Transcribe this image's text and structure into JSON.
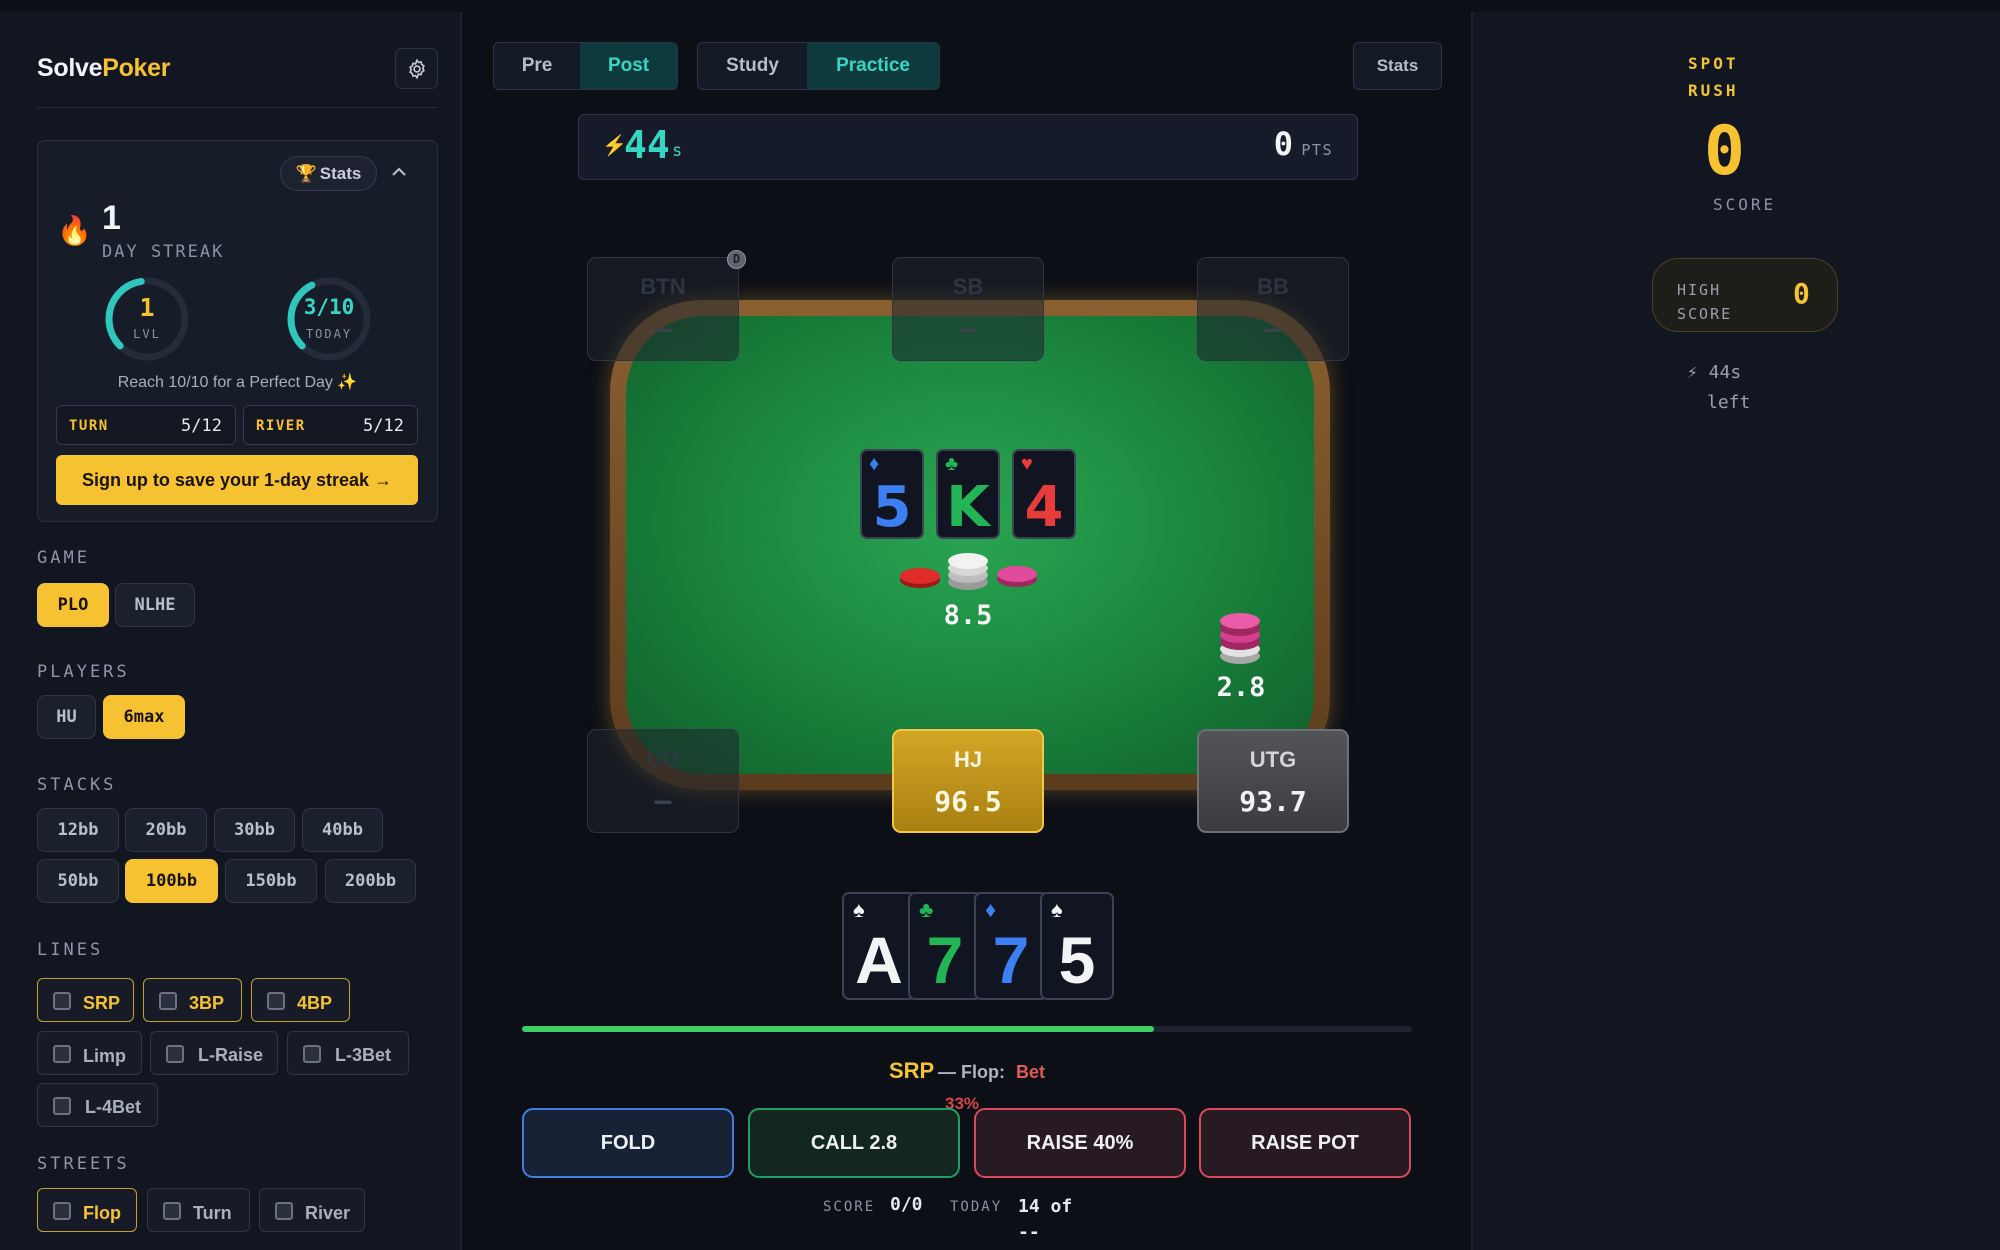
{
  "brand": {
    "part1": "Solve",
    "part2": "Poker"
  },
  "streak_card": {
    "stats_label": "Stats",
    "days": "1",
    "days_label": "DAY STREAK",
    "level": {
      "value": "1",
      "label": "LVL",
      "progress": 0.35
    },
    "today": {
      "value": "3/10",
      "label": "TODAY",
      "progress": 0.3
    },
    "perfect_text": "Reach 10/10 for a Perfect Day ✨",
    "turn": {
      "label": "TURN",
      "value": "5/12"
    },
    "river": {
      "label": "RIVER",
      "value": "5/12"
    },
    "signup_label": "Sign up to save your 1-day streak →"
  },
  "filters": {
    "game": {
      "title": "GAME",
      "options": [
        "PLO",
        "NLHE"
      ],
      "selected": "PLO"
    },
    "players": {
      "title": "PLAYERS",
      "options": [
        "HU",
        "6max"
      ],
      "selected": "6max"
    },
    "stacks": {
      "title": "STACKS",
      "options": [
        "12bb",
        "20bb",
        "30bb",
        "40bb",
        "50bb",
        "100bb",
        "150bb",
        "200bb"
      ],
      "selected": "100bb"
    },
    "lines": {
      "title": "LINES",
      "options": [
        "SRP",
        "3BP",
        "4BP",
        "Limp",
        "L-Raise",
        "L-3Bet",
        "L-4Bet"
      ]
    },
    "streets": {
      "title": "STREETS",
      "options": [
        "Flop",
        "Turn",
        "River"
      ]
    }
  },
  "topbar": {
    "mode_tabs": [
      "Pre",
      "Post"
    ],
    "mode_selected": "Post",
    "view_tabs": [
      "Study",
      "Practice"
    ],
    "view_selected": "Practice",
    "stats_label": "Stats"
  },
  "timer": {
    "seconds": "44",
    "unit": "s",
    "points": "0",
    "points_unit": "PTS"
  },
  "table": {
    "dealer_marker": "D",
    "seats": [
      {
        "pos": "BTN",
        "stack": "—"
      },
      {
        "pos": "SB",
        "stack": "—"
      },
      {
        "pos": "BB",
        "stack": "—"
      },
      {
        "pos": "CO",
        "stack": "—"
      },
      {
        "pos": "HJ",
        "stack": "96.5"
      },
      {
        "pos": "UTG",
        "stack": "93.7"
      }
    ],
    "board": [
      {
        "rank": "5",
        "suit": "♦",
        "color": "#3b7ff2"
      },
      {
        "rank": "K",
        "suit": "♣",
        "color": "#22b455"
      },
      {
        "rank": "4",
        "suit": "♥",
        "color": "#e83b3b"
      }
    ],
    "pot": "8.5",
    "utg_bet": "2.8"
  },
  "hero_hand": [
    {
      "rank": "A",
      "suit": "♠",
      "color": "#f2f3f5"
    },
    {
      "rank": "7",
      "suit": "♣",
      "color": "#22b455"
    },
    {
      "rank": "7",
      "suit": "♦",
      "color": "#3b7ff2"
    },
    {
      "rank": "5",
      "suit": "♠",
      "color": "#f2f3f5"
    }
  ],
  "progress": 0.71,
  "spot": {
    "line": "SRP",
    "street": "— Flop:",
    "action": "Bet",
    "action_size": "33%"
  },
  "actions": [
    "FOLD",
    "CALL 2.8",
    "RAISE 40%",
    "RAISE POT"
  ],
  "footer": {
    "score_label": "SCORE",
    "score": "0/0",
    "today_label": "TODAY",
    "today": "14 of --"
  },
  "spot_rush": {
    "title_line1": "SPOT",
    "title_line2": "RUSH",
    "score": "0",
    "score_label": "SCORE",
    "high_score_line1": "HIGH",
    "high_score_line2": "SCORE",
    "high_score": "0",
    "time_left_line1": "⚡ 44s",
    "time_left_line2": "left"
  },
  "colors": {
    "accent": "#f6c232",
    "teal": "#37d6c4",
    "fold": "#3f7fe0",
    "call": "#1f9f63",
    "raise": "#d84a5a"
  }
}
